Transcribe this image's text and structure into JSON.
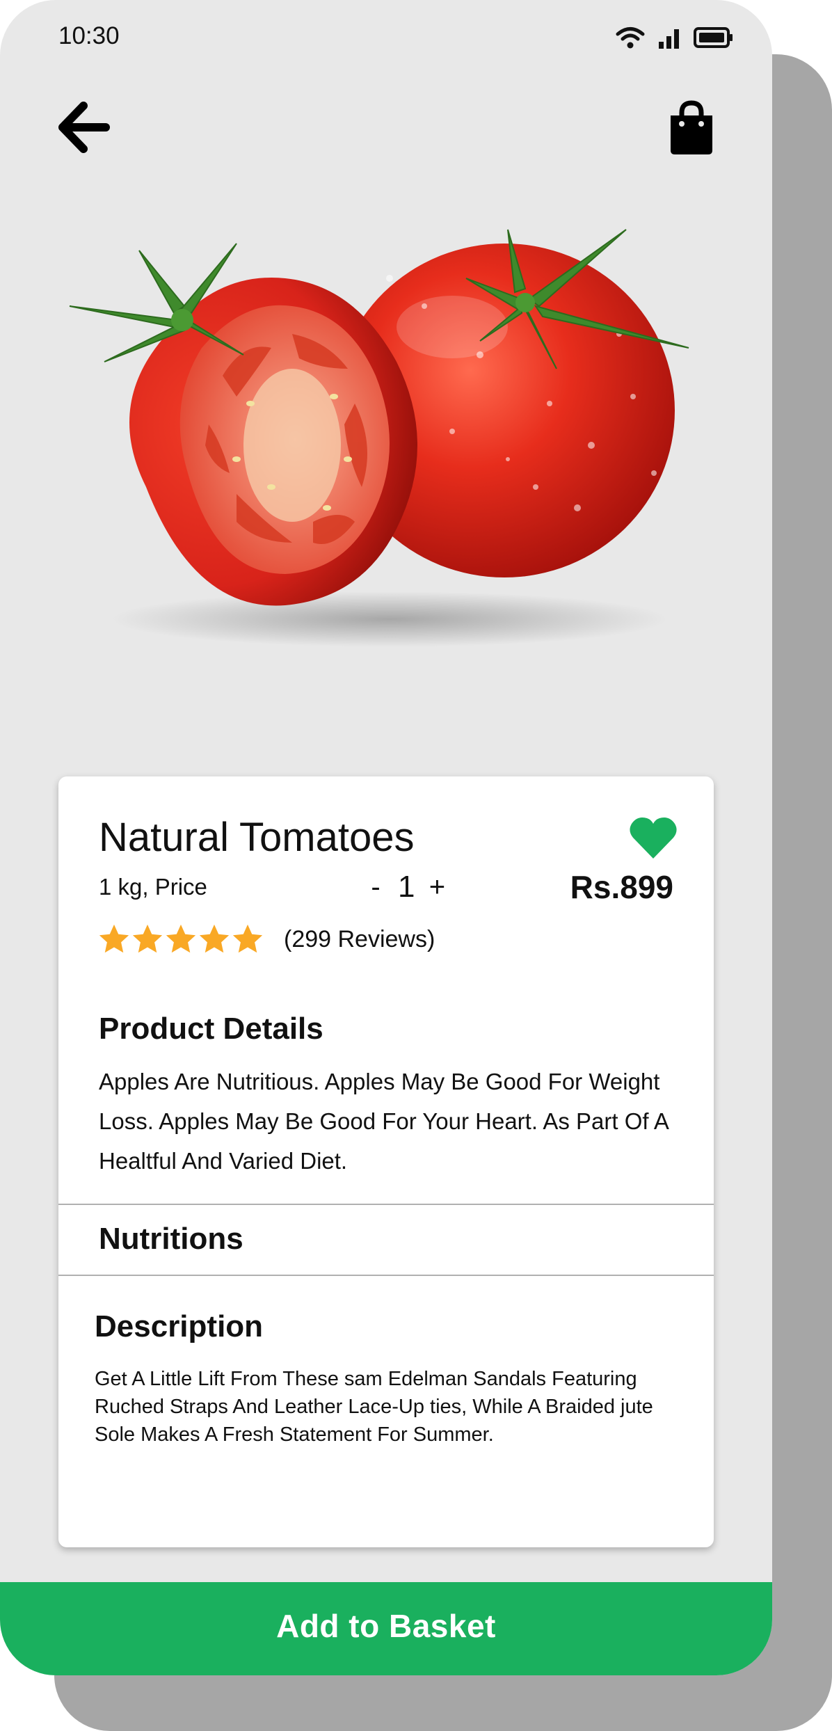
{
  "status_bar": {
    "time": "10:30"
  },
  "header": {
    "back_icon": "arrow-left-icon",
    "bag_icon": "shopping-bag-icon"
  },
  "product": {
    "image": "tomato-image",
    "name": "Natural Tomatoes",
    "unit_label": "1 kg, Price",
    "quantity": {
      "minus_label": "-",
      "value": "1",
      "plus_label": "+"
    },
    "price": "Rs.899",
    "favorite": true,
    "rating": {
      "stars": 5,
      "reviews_label": "(299 Reviews)"
    }
  },
  "details": {
    "title": "Product Details",
    "text": "Apples Are Nutritious. Apples May Be Good For Weight Loss. Apples May Be Good For Your Heart. As Part Of A Healtful And Varied Diet."
  },
  "nutritions": {
    "title": "Nutritions"
  },
  "description": {
    "title": "Description",
    "text": "Get A Little Lift From These sam Edelman Sandals Featuring Ruched Straps And Leather Lace-Up ties, While A Braided jute Sole Makes A Fresh Statement For Summer."
  },
  "cta": {
    "label": "Add to Basket"
  },
  "colors": {
    "accent": "#1ab05e",
    "background": "#e8e8e8",
    "star": "#f9a825",
    "heart": "#1ab05e"
  }
}
